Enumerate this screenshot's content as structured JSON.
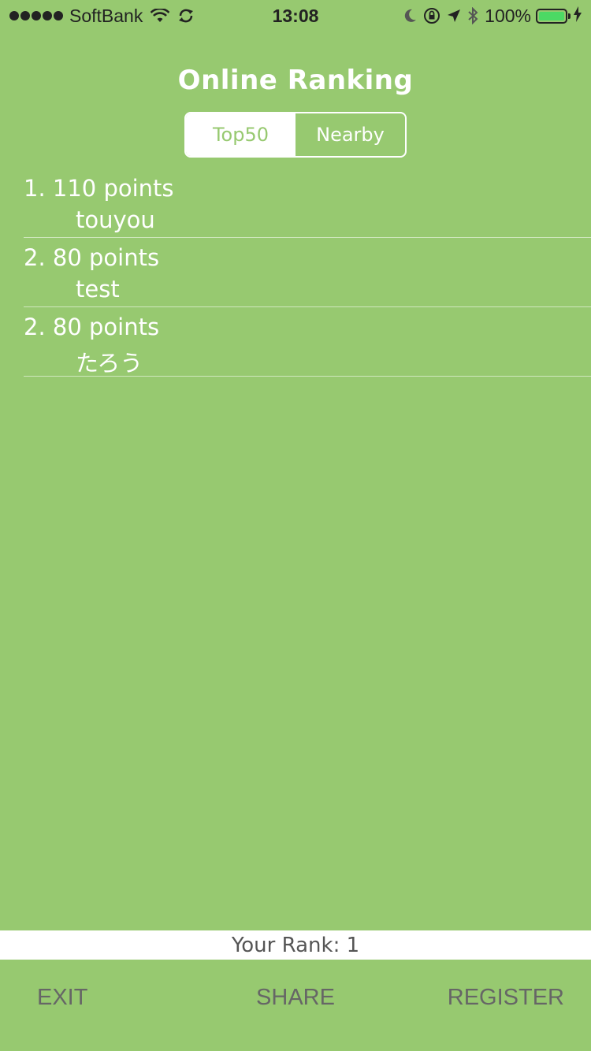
{
  "status_bar": {
    "carrier": "SoftBank",
    "time": "13:08",
    "battery_percent": "100%",
    "icons": [
      "signal-dots-icon",
      "wifi-icon",
      "sync-icon",
      "moon-icon",
      "rotation-lock-icon",
      "location-arrow-icon",
      "bluetooth-icon",
      "battery-icon",
      "charging-bolt-icon"
    ],
    "battery_color": "#4cd964"
  },
  "header": {
    "title": "Online Ranking"
  },
  "segmented_control": {
    "selected": "Top50",
    "options": [
      "Top50",
      "Nearby"
    ]
  },
  "ranking": {
    "rows": [
      {
        "score_line": "1. 110 points",
        "name": "touyou"
      },
      {
        "score_line": "2. 80 points",
        "name": "test"
      },
      {
        "score_line": "2. 80 points",
        "name": "たろう"
      }
    ]
  },
  "your_rank": {
    "text": "Your Rank: 1"
  },
  "bottom_bar": {
    "exit_label": "EXIT",
    "share_label": "SHARE",
    "register_label": "REGISTER"
  },
  "colors": {
    "background": "#97c970",
    "text_light": "#ffffff",
    "button_text": "#666666"
  }
}
